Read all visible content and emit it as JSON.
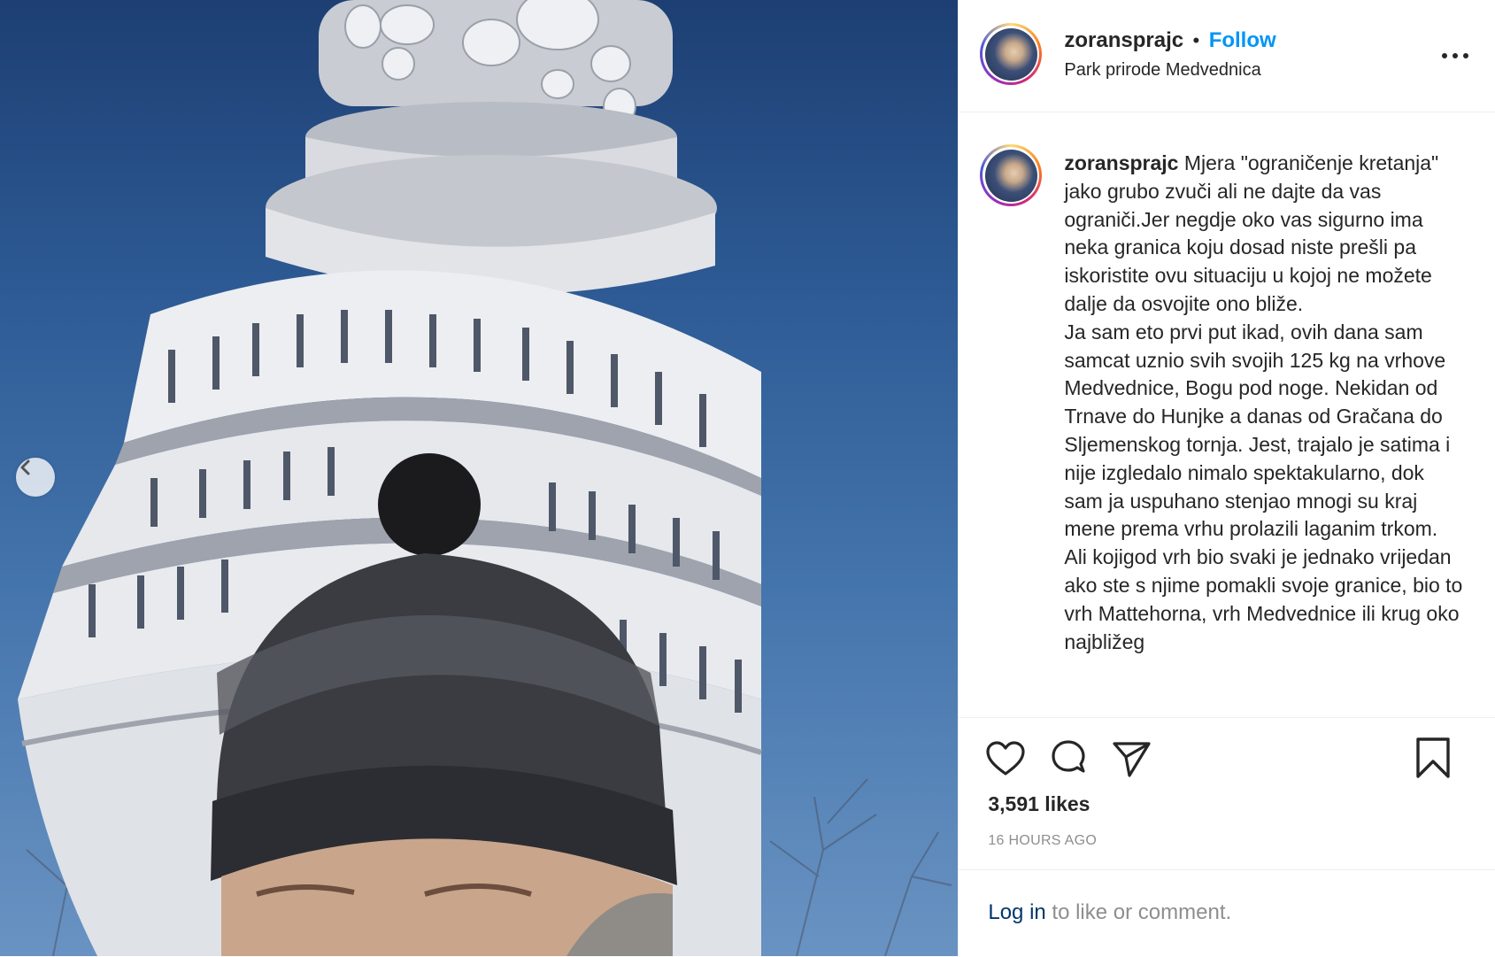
{
  "post": {
    "username": "zoransprajc",
    "follow_label": "Follow",
    "separator": "•",
    "location": "Park prirode Medvednica"
  },
  "caption": {
    "username": "zoransprajc",
    "text": "Mjera \"ograničenje kretanja\" jako grubo zvuči ali ne dajte da vas ograniči.Jer negdje oko vas sigurno ima neka granica koju dosad niste prešli pa iskoristite ovu situaciju u kojoj ne možete dalje da osvojite ono bliže.\nJa sam eto prvi put ikad, ovih dana sam samcat uznio svih svojih 125 kg na vrhove Medvednice, Bogu pod noge. Nekidan od Trnave do Hunjke a danas od Gračana do Sljemenskog tornja. Jest, trajalo je satima i nije izgledalo nimalo spektakularno, dok sam ja uspuhano stenjao mnogi su kraj mene prema vrhu prolazili laganim trkom. Ali kojigod vrh bio svaki je jednako vrijedan ako ste s njime pomakli svoje granice, bio to vrh Mattehorna, vrh Medvednice ili krug oko najbližeg"
  },
  "stats": {
    "likes": "3,591 likes",
    "time_ago": "16 HOURS AGO"
  },
  "login": {
    "link": "Log in",
    "rest": " to like or comment."
  },
  "icons": {
    "prev": "chevron-left-icon",
    "more": "more-options-icon",
    "like": "heart-icon",
    "comment": "comment-icon",
    "share": "send-icon",
    "save": "bookmark-icon"
  },
  "colors": {
    "follow": "#0095f6",
    "login_link": "#00376b",
    "muted": "#8e8e8e",
    "text": "#262626"
  }
}
